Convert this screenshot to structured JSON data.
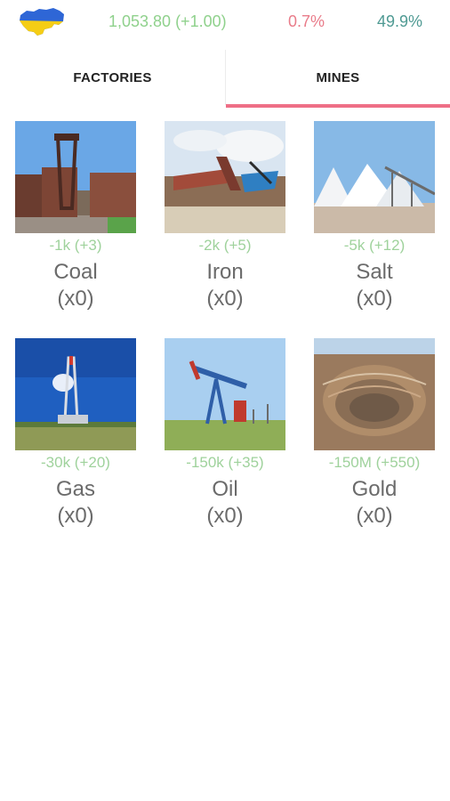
{
  "header": {
    "flag_icon": "ukraine-flag-map",
    "money": "1,053.80 (+1.00)",
    "percent_left": "0.7%",
    "percent_right": "49.9%"
  },
  "tabs": [
    {
      "label": "FACTORIES"
    },
    {
      "label": "MINES"
    }
  ],
  "mines": [
    {
      "price": "-1k (+3)",
      "name": "Coal",
      "count": "(x0)"
    },
    {
      "price": "-2k (+5)",
      "name": "Iron",
      "count": "(x0)"
    },
    {
      "price": "-5k (+12)",
      "name": "Salt",
      "count": "(x0)"
    },
    {
      "price": "-30k (+20)",
      "name": "Gas",
      "count": "(x0)"
    },
    {
      "price": "-150k (+35)",
      "name": "Oil",
      "count": "(x0)"
    },
    {
      "price": "-150M (+550)",
      "name": "Gold",
      "count": "(x0)"
    }
  ],
  "colors": {
    "money": "#8fd18c",
    "percent_left": "#e97c8a",
    "percent_right": "#4f9a93",
    "tab_accent": "#ee6f86",
    "price": "#9fd29c"
  }
}
